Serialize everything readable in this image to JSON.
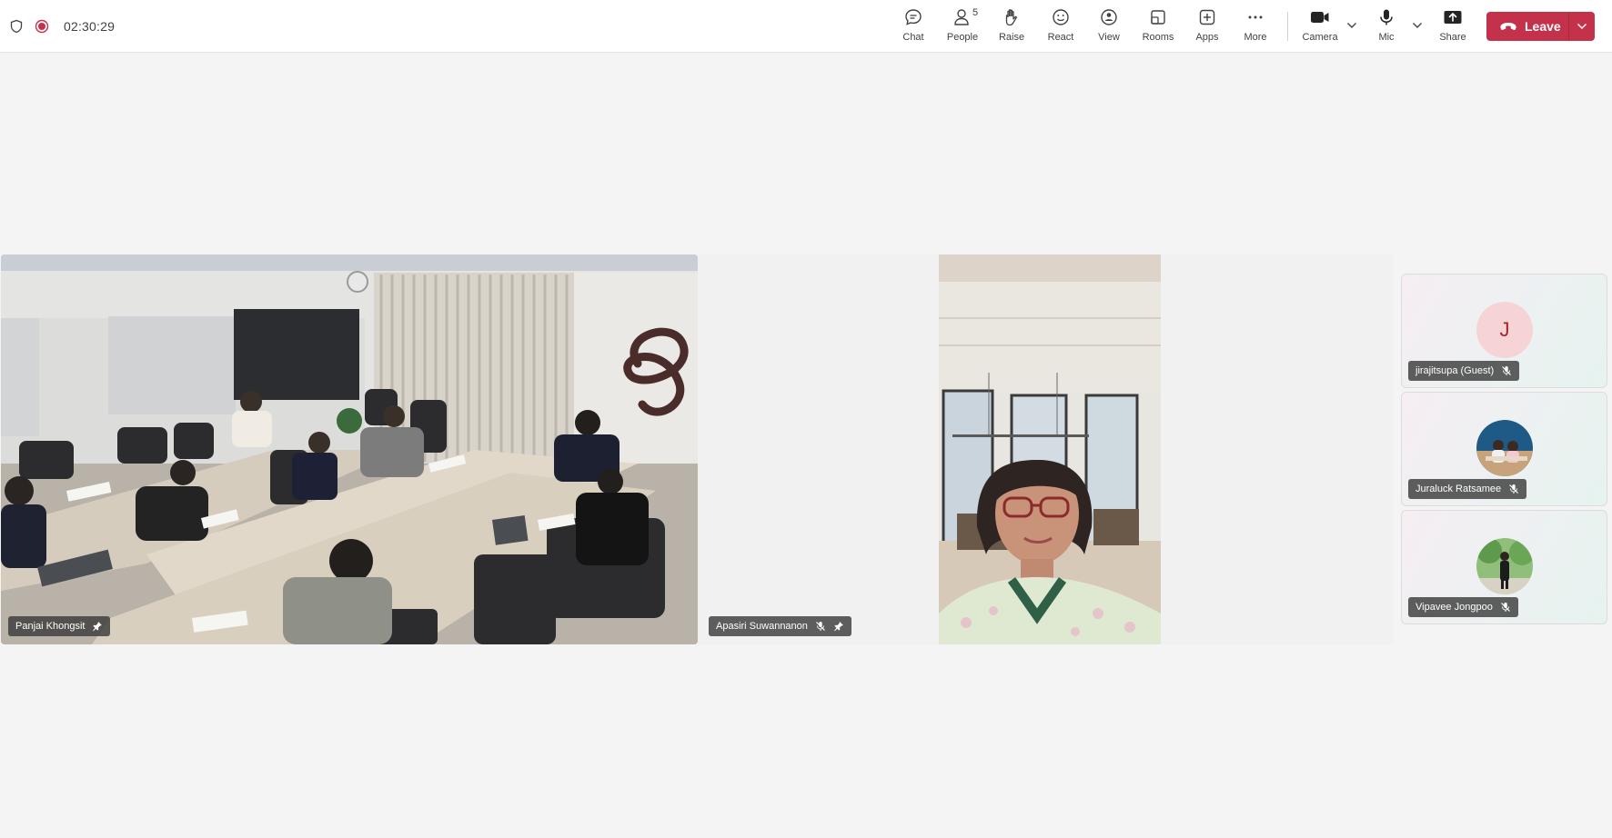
{
  "topbar": {
    "timer": "02:30:29",
    "buttons": {
      "chat": "Chat",
      "people": "People",
      "people_count": "5",
      "raise": "Raise",
      "react": "React",
      "view": "View",
      "rooms": "Rooms",
      "apps": "Apps",
      "more": "More",
      "camera": "Camera",
      "mic": "Mic",
      "share": "Share"
    },
    "leave_label": "Leave"
  },
  "participants": {
    "main_left": {
      "name": "Panjai Khongsit"
    },
    "main_center": {
      "name": "Apasiri Suwannanon"
    },
    "rail": [
      {
        "name": "jirajitsupa (Guest)",
        "initial": "J"
      },
      {
        "name": "Juraluck Ratsamee"
      },
      {
        "name": "Vipavee Jongpoo"
      }
    ]
  },
  "colors": {
    "leave": "#c4314b",
    "recording": "#c4314b",
    "stage_bg": "#f4f4f4"
  },
  "icons": [
    "shield-icon",
    "record-icon",
    "chat-icon",
    "people-icon",
    "hand-icon",
    "smile-icon",
    "view-icon",
    "rooms-icon",
    "apps-icon",
    "more-icon",
    "camera-icon",
    "mic-icon",
    "share-icon",
    "phone-icon",
    "pin-icon",
    "mic-off-icon"
  ]
}
